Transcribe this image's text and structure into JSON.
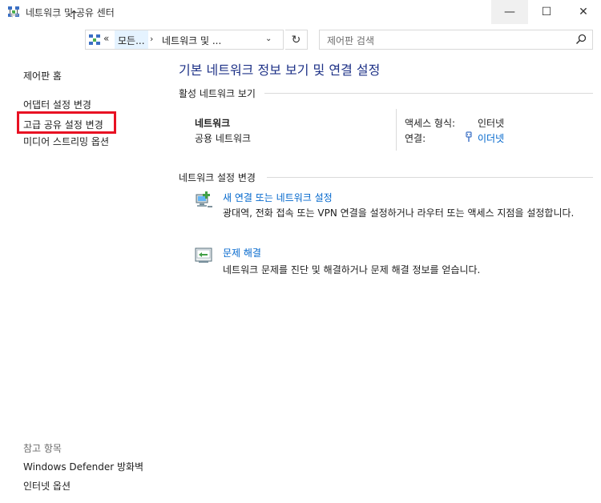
{
  "window": {
    "title": "네트워크 및 공유 센터",
    "min_glyph": "—",
    "max_glyph": "☐",
    "close_glyph": "✕"
  },
  "nav": {
    "back_glyph": "←",
    "forward_glyph": "→",
    "dropdown_glyph": "⌄",
    "up_glyph": "↑",
    "address": {
      "overflow_glyph": "«",
      "crumb1": "모든...",
      "separator": "›",
      "crumb2": "네트워크 및 ...",
      "dropdown_glyph": "⌄"
    },
    "refresh_glyph": "↻",
    "search_placeholder": "제어판 검색"
  },
  "sidebar": {
    "home": "제어판 홈",
    "items": [
      "어댑터 설정 변경",
      "고급 공유 설정 변경",
      "미디어 스트리밍 옵션"
    ],
    "see_also_title": "참고 항목",
    "see_also": [
      "Windows Defender 방화벽",
      "인터넷 옵션"
    ]
  },
  "main": {
    "title": "기본 네트워크 정보 보기 및 연결 설정",
    "active_section": "활성 네트워크 보기",
    "network": {
      "name": "네트워크",
      "type": "공용 네트워크",
      "access_label": "액세스 형식:",
      "access_value": "인터넷",
      "connection_label": "연결:",
      "connection_value": "이더넷"
    },
    "change_section": "네트워크 설정 변경",
    "tasks": [
      {
        "label": "새 연결 또는 네트워크 설정",
        "description": "광대역, 전화 접속 또는 VPN 연결을 설정하거나 라우터 또는 액세스 지점을 설정합니다."
      },
      {
        "label": "문제 해결",
        "description": "네트워크 문제를 진단 및 해결하거나 문제 해결 정보를 얻습니다."
      }
    ]
  },
  "colors": {
    "title_blue": "#1e3287",
    "link_blue": "#0066cc",
    "highlight_red": "#e81123"
  }
}
